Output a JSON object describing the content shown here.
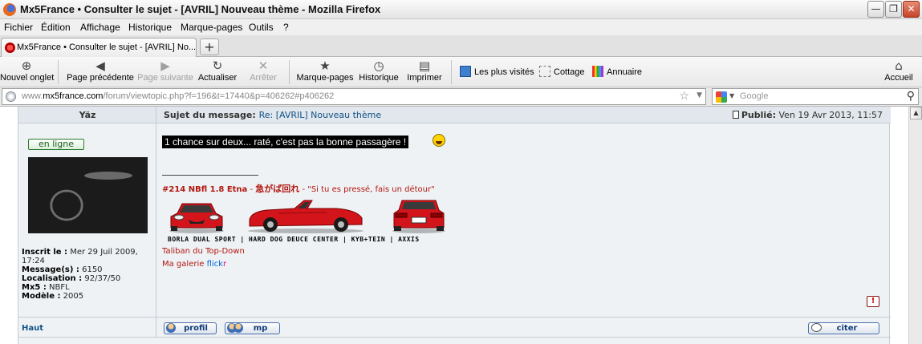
{
  "window": {
    "title": "Mx5France • Consulter le sujet - [AVRIL] Nouveau thème - Mozilla Firefox",
    "minimize": "—",
    "restore": "❐",
    "close": "✕"
  },
  "menu": {
    "items": [
      "Fichier",
      "Édition",
      "Affichage",
      "Historique",
      "Marque-pages",
      "Outils",
      "?"
    ]
  },
  "tab": {
    "label": "Mx5France • Consulter le sujet - [AVRIL] No...",
    "new_tab": "+"
  },
  "toolbar": {
    "new_tab": "Nouvel onglet",
    "back": "Page précédente",
    "forward": "Page suivante",
    "reload": "Actualiser",
    "stop": "Arrêter",
    "bookmarks": "Marque-pages",
    "history": "Historique",
    "print": "Imprimer",
    "home": "Accueil",
    "icons": {
      "new_tab": "⊕",
      "back": "◀",
      "forward": "▶",
      "reload": "↻",
      "stop": "✕",
      "bookmarks": "★",
      "history": "◷",
      "print": "▤",
      "home": "⌂"
    }
  },
  "bookmarks_bar": {
    "items": [
      "Les plus visités",
      "Cottage",
      "Annuaire"
    ]
  },
  "address": {
    "url_prefix": "www.",
    "url_host": "mx5france.com",
    "url_path": "/forum/viewtopic.php?f=196&t=17440&p=406262#p406262",
    "star": "☆",
    "dropdown": "▼"
  },
  "search": {
    "placeholder": "Google",
    "dropdown": "▼",
    "magnifier": "⚲"
  },
  "post": {
    "author": "Yäz",
    "subject_label": "Sujet du message:",
    "subject": "Re: [AVRIL] Nouveau thème",
    "posted_label": "Publié:",
    "posted_date": "Ven 19 Avr 2013, 11:57",
    "online": "en ligne",
    "message": "1 chance sur deux... raté, c'est pas la bonne passagère !",
    "profile": {
      "joined_label": "Inscrit le :",
      "joined": "Mer 29 Juil 2009, 17:24",
      "messages_label": "Message(s) :",
      "messages": "6150",
      "location_label": "Localisation :",
      "location": "92/37/50",
      "mx5_label": "Mx5 :",
      "mx5": "NBFL",
      "model_label": "Modèle :",
      "model": "2005"
    },
    "signature": {
      "car": "#214 NBfl 1.8 Etna",
      "dash1": " - ",
      "japanese": "急がば回れ",
      "dash2": " - ",
      "motto": "\"Si tu es pressé, fais un détour\"",
      "sponsors": "BORLA DUAL SPORT | HARD DOG DEUCE CENTER | KYB+TEIN | AXXIS",
      "tagline": "Taliban du Top-Down",
      "gallery": "Ma galerie",
      "flickr_a": "flick",
      "flickr_b": "r"
    },
    "report": "!",
    "top_link": "Haut",
    "buttons": {
      "profile": "profil",
      "pm": "mp",
      "quote": "citer"
    }
  },
  "colors": {
    "car_red": "#d4141b",
    "link_blue": "#105289",
    "signature_red": "#b2170f",
    "post_bg": "#eef2f5"
  },
  "scrollbar": {
    "up": "▲"
  }
}
